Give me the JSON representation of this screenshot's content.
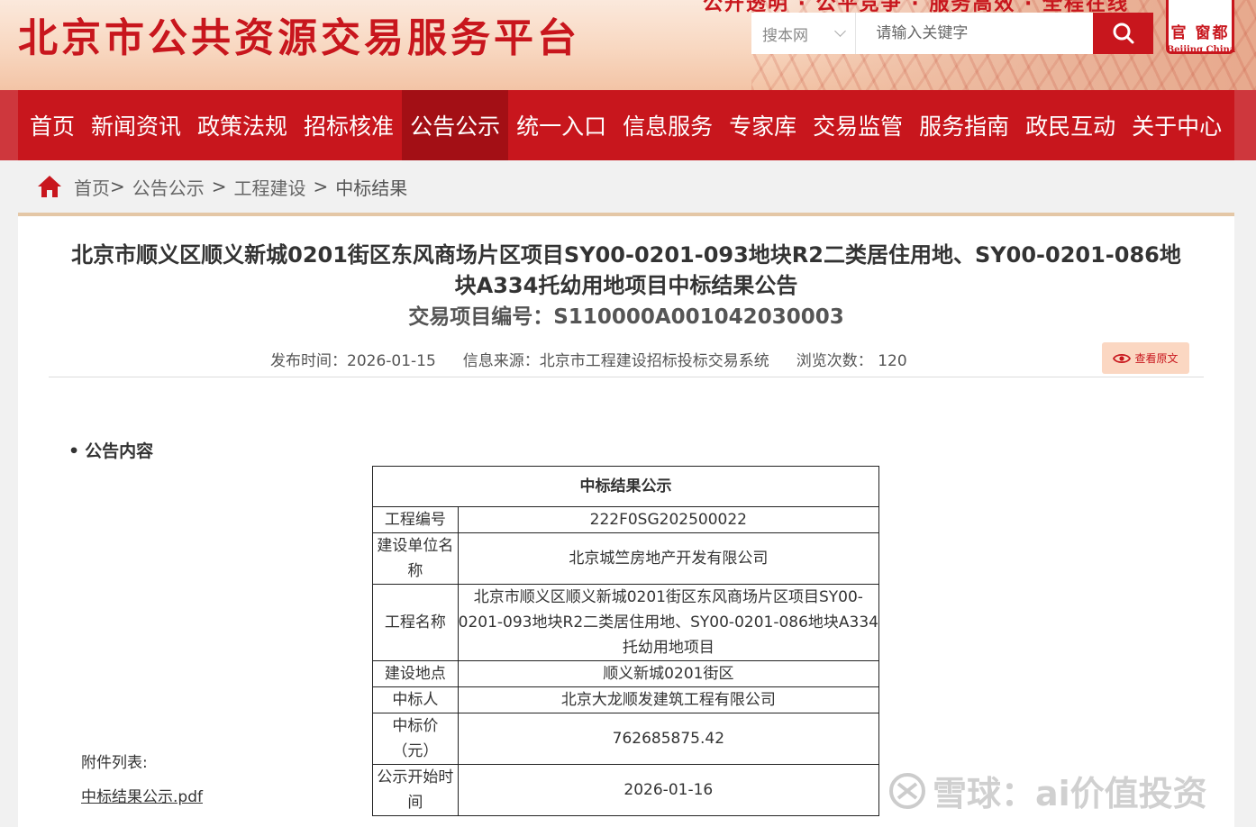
{
  "header": {
    "site_title": "北京市公共资源交易服务平台",
    "top_links": "公开透明 · 公平竞争 · 服务高效 · 全程在线",
    "search": {
      "scope_label": "搜本网",
      "placeholder": "请输入关键字"
    },
    "logo_text": "官 窗都",
    "logo_sub": "Beijing China"
  },
  "nav": {
    "items": [
      "首页",
      "新闻资讯",
      "政策法规",
      "招标核准",
      "公告公示",
      "统一入口",
      "信息服务",
      "专家库",
      "交易监管",
      "服务指南",
      "政民互动",
      "关于中心"
    ],
    "active_index": 4
  },
  "breadcrumb": {
    "items": [
      "首页",
      "公告公示",
      "工程建设",
      "中标结果"
    ]
  },
  "article": {
    "title_line1": "北京市顺义区顺义新城0201街区东风商场片区项目SY00-0201-093地块R2二类居住用地、SY00-0201-086地",
    "title_line2": "块A334托幼用地项目中标结果公告",
    "code": "交易项目编号：S110000A001042030003",
    "meta": {
      "publish_time": "发布时间：2026-01-15",
      "source": "信息来源：北京市工程建设招标投标交易系统",
      "views_label": "浏览次数：",
      "views": "120"
    },
    "view_original_label": "查看原文",
    "section_title": "公告内容",
    "table": {
      "caption": "中标结果公示",
      "rows": [
        {
          "k": "工程编号",
          "v": "222F0SG202500022"
        },
        {
          "k": "建设单位名称",
          "v": "北京城竺房地产开发有限公司"
        },
        {
          "k": "工程名称",
          "v_lines": [
            "北京市顺义区顺义新城0201街区东风商场片区项目SY00-",
            "0201-093地块R2二类居住用地、SY00-0201-086地块A334",
            "托幼用地项目"
          ]
        },
        {
          "k": "建设地点",
          "v": "顺义新城0201街区"
        },
        {
          "k": "中标人",
          "v": "北京大龙顺发建筑工程有限公司"
        },
        {
          "k": "中标价（元）",
          "v": "762685875.42"
        },
        {
          "k": "公示开始时间",
          "v": "2026-01-16"
        }
      ]
    },
    "attachments_label": "附件列表:",
    "attachment_file": "中标结果公示.pdf"
  },
  "watermark": "雪球：ai价值投资",
  "colors": {
    "brand_red": "#c8161d",
    "nav_active": "#a30f15",
    "view_btn_bg": "#fbd7c2"
  }
}
